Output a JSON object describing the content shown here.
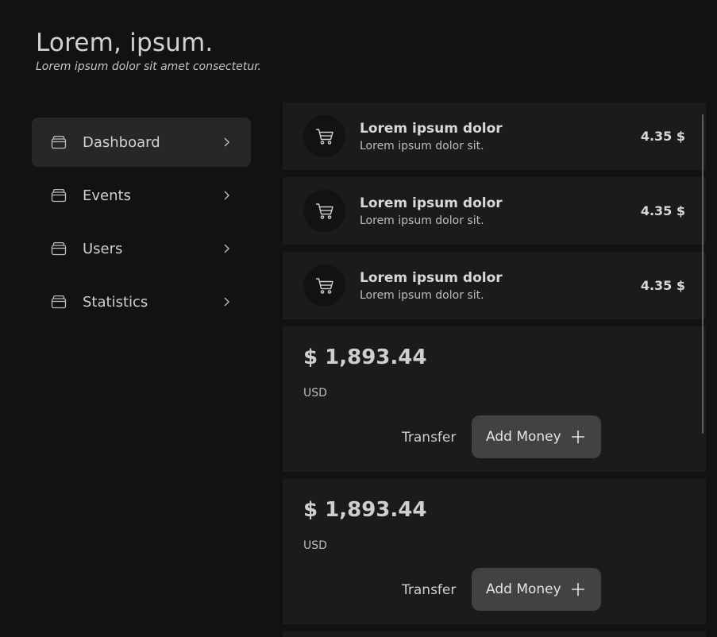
{
  "header": {
    "title": "Lorem, ipsum.",
    "subtitle": "Lorem ipsum dolor sit amet consectetur."
  },
  "sidebar": {
    "items": [
      {
        "label": "Dashboard",
        "icon": "wallet-icon",
        "active": true
      },
      {
        "label": "Events",
        "icon": "wallet-icon",
        "active": false
      },
      {
        "label": "Users",
        "icon": "wallet-icon",
        "active": false
      },
      {
        "label": "Statistics",
        "icon": "wallet-icon",
        "active": false
      }
    ]
  },
  "transactions": [
    {
      "title": "Lorem ipsum dolor",
      "subtitle": "Lorem ipsum dolor sit.",
      "amount": "4.35 $",
      "icon": "cart-icon"
    },
    {
      "title": "Lorem ipsum dolor",
      "subtitle": "Lorem ipsum dolor sit.",
      "amount": "4.35 $",
      "icon": "cart-icon"
    },
    {
      "title": "Lorem ipsum dolor",
      "subtitle": "Lorem ipsum dolor sit.",
      "amount": "4.35 $",
      "icon": "cart-icon"
    }
  ],
  "balances": [
    {
      "amount": "$ 1,893.44",
      "currency": "USD",
      "transfer_label": "Transfer",
      "add_label": "Add Money"
    },
    {
      "amount": "$ 1,893.44",
      "currency": "USD",
      "transfer_label": "Transfer",
      "add_label": "Add Money"
    }
  ],
  "colors": {
    "background": "#121212",
    "card": "#1b1b1b",
    "active_nav": "#272727",
    "button": "#424242",
    "text": "#d6d6d6"
  }
}
